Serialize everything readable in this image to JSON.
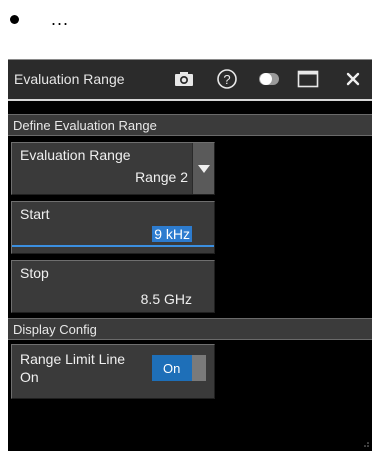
{
  "bullet": {
    "text": "..."
  },
  "dialog": {
    "title": "Evaluation Range",
    "icons": [
      "camera-icon",
      "help-icon",
      "toggle-icon",
      "window-icon",
      "close-icon"
    ],
    "help_glyph": "?",
    "close_glyph": "✕"
  },
  "sections": {
    "define": "Define Evaluation Range",
    "display": "Display Config"
  },
  "evaluation_range": {
    "label": "Evaluation Range",
    "value": "Range 2"
  },
  "start": {
    "label": "Start",
    "value": "9 kHz"
  },
  "stop": {
    "label": "Stop",
    "value": "8.5 GHz"
  },
  "range_limit_line": {
    "label_line1": "Range Limit Line",
    "label_line2": "On",
    "switch_text": "On"
  },
  "colors": {
    "accent": "#2d7ccf",
    "panel": "#3a3a3a",
    "background": "#000000",
    "titlebar": "#2b2b2b"
  }
}
